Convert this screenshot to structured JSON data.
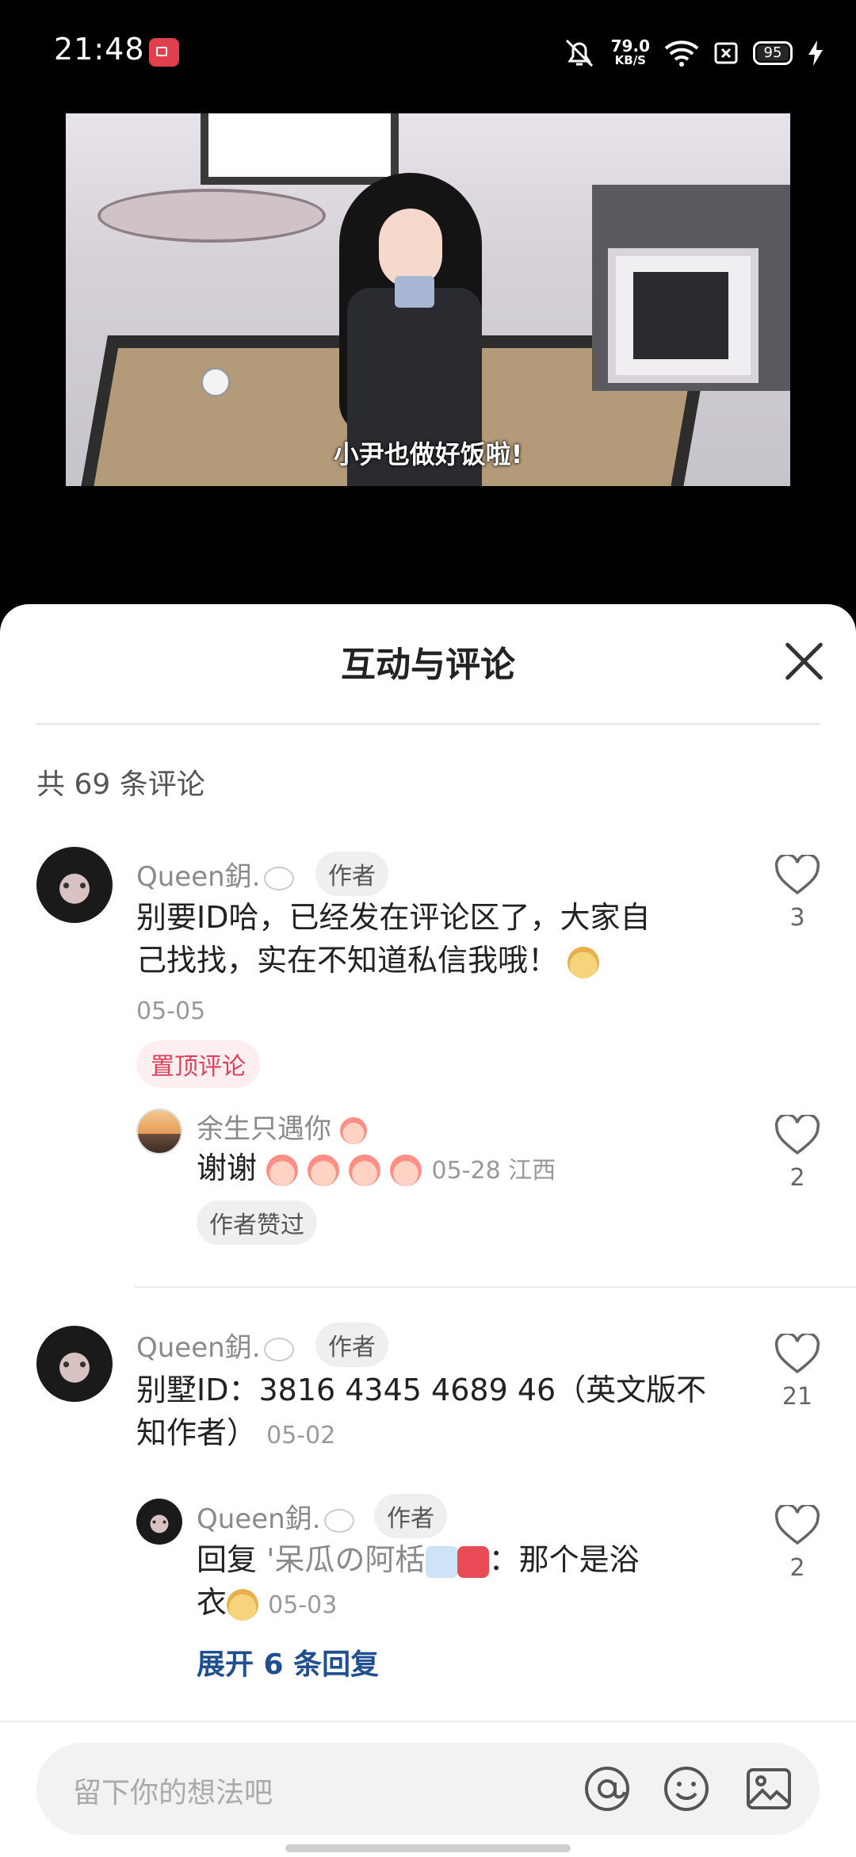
{
  "status_bar": {
    "time": "21:48",
    "speed_value": "79.0",
    "speed_unit": "KB/S",
    "battery": "95"
  },
  "video": {
    "subtitle": "小尹也做好饭啦!"
  },
  "sheet": {
    "title": "互动与评论",
    "count": "共 69 条评论"
  },
  "comments": [
    {
      "user": "Queen鈅.",
      "badge": "作者",
      "text_line1": "别要ID哈，已经发在评论区了，大家自",
      "text_line2": "己找找，实在不知道私信我哦！",
      "date": "05-05",
      "pinned": "置顶评论",
      "likes": "3",
      "reply": {
        "user": "余生只遇你",
        "text": "谢谢",
        "date_loc": "05-28 江西",
        "author_liked": "作者赞过",
        "likes": "2"
      }
    },
    {
      "user": "Queen鈅.",
      "badge": "作者",
      "text_line1": "别墅ID：3816 4345 4689 46（英文版不",
      "text_line2": "知作者）",
      "date": "05-02",
      "likes": "21",
      "reply": {
        "user": "Queen鈅.",
        "badge": "作者",
        "text_line1_prefix": "回复",
        "text_line1_target": "'呆瓜の阿栝",
        "text_line1_rest": "：那个是浴",
        "text_line2": "衣",
        "date": "05-03",
        "likes": "2"
      },
      "expand": "展开 6 条回复"
    }
  ],
  "input": {
    "placeholder": "留下你的想法吧"
  },
  "icons": [
    "camera-record-icon",
    "mute-icon",
    "wifi-icon",
    "sim-icon",
    "battery-icon",
    "charging-icon",
    "close-icon",
    "heart-icon",
    "at-icon",
    "emoji-icon",
    "image-icon"
  ]
}
